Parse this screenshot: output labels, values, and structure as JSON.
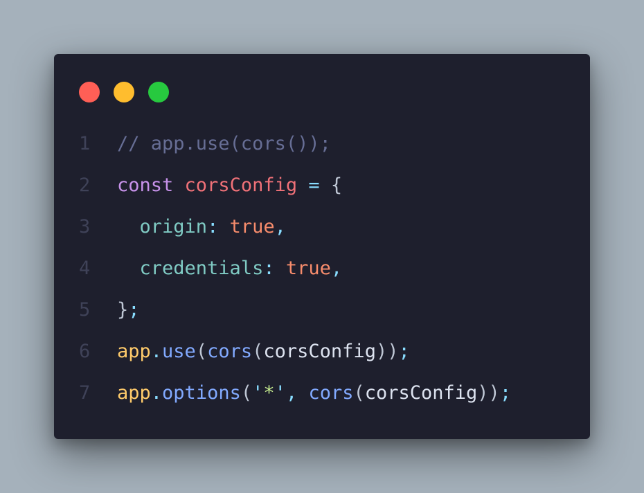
{
  "theme": {
    "background": "#a5b1bb",
    "window": "#1e1f2d",
    "dot_red": "#ff5f56",
    "dot_yellow": "#ffbd2e",
    "dot_green": "#27c93f"
  },
  "code": {
    "language": "javascript",
    "lines": [
      {
        "number": "1",
        "tokens": [
          {
            "text": "// app.use(cors());",
            "kind": "comment"
          }
        ]
      },
      {
        "number": "2",
        "tokens": [
          {
            "text": "const",
            "kind": "keyword"
          },
          {
            "text": " ",
            "kind": "plain"
          },
          {
            "text": "corsConfig",
            "kind": "var"
          },
          {
            "text": " ",
            "kind": "plain"
          },
          {
            "text": "=",
            "kind": "op"
          },
          {
            "text": " ",
            "kind": "plain"
          },
          {
            "text": "{",
            "kind": "punct"
          }
        ]
      },
      {
        "number": "3",
        "tokens": [
          {
            "text": "  ",
            "kind": "plain"
          },
          {
            "text": "origin",
            "kind": "prop"
          },
          {
            "text": ":",
            "kind": "op"
          },
          {
            "text": " ",
            "kind": "plain"
          },
          {
            "text": "true",
            "kind": "bool"
          },
          {
            "text": ",",
            "kind": "op"
          }
        ]
      },
      {
        "number": "4",
        "tokens": [
          {
            "text": "  ",
            "kind": "plain"
          },
          {
            "text": "credentials",
            "kind": "prop"
          },
          {
            "text": ":",
            "kind": "op"
          },
          {
            "text": " ",
            "kind": "plain"
          },
          {
            "text": "true",
            "kind": "bool"
          },
          {
            "text": ",",
            "kind": "op"
          }
        ]
      },
      {
        "number": "5",
        "tokens": [
          {
            "text": "}",
            "kind": "punct"
          },
          {
            "text": ";",
            "kind": "op"
          }
        ]
      },
      {
        "number": "6",
        "tokens": [
          {
            "text": "app",
            "kind": "obj"
          },
          {
            "text": ".",
            "kind": "op"
          },
          {
            "text": "use",
            "kind": "fn"
          },
          {
            "text": "(",
            "kind": "punct"
          },
          {
            "text": "cors",
            "kind": "fn"
          },
          {
            "text": "(",
            "kind": "punct"
          },
          {
            "text": "corsConfig",
            "kind": "plain"
          },
          {
            "text": "))",
            "kind": "punct"
          },
          {
            "text": ";",
            "kind": "op"
          }
        ]
      },
      {
        "number": "7",
        "tokens": [
          {
            "text": "app",
            "kind": "obj"
          },
          {
            "text": ".",
            "kind": "op"
          },
          {
            "text": "options",
            "kind": "fn"
          },
          {
            "text": "(",
            "kind": "punct"
          },
          {
            "text": "'",
            "kind": "op"
          },
          {
            "text": "*",
            "kind": "str"
          },
          {
            "text": "'",
            "kind": "op"
          },
          {
            "text": ",",
            "kind": "op"
          },
          {
            "text": " ",
            "kind": "plain"
          },
          {
            "text": "cors",
            "kind": "fn"
          },
          {
            "text": "(",
            "kind": "punct"
          },
          {
            "text": "corsConfig",
            "kind": "plain"
          },
          {
            "text": "))",
            "kind": "punct"
          },
          {
            "text": ";",
            "kind": "op"
          }
        ]
      }
    ]
  }
}
